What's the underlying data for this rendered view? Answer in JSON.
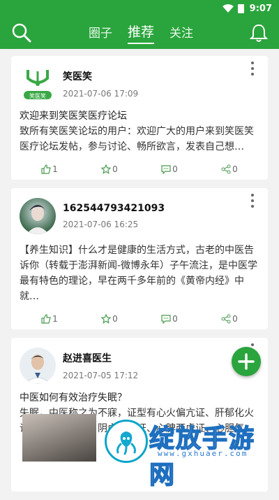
{
  "status_bar": {
    "time": "9:07"
  },
  "header": {
    "tabs": [
      {
        "label": "圈子"
      },
      {
        "label": "推荐",
        "active": true
      },
      {
        "label": "关注"
      }
    ]
  },
  "posts": [
    {
      "author": "笑医笑",
      "logo_text": "笑医笑",
      "date": "2021-07-06 17:09",
      "title": "欢迎来到笑医笑医疗论坛",
      "body": "致所有笑医笑论坛的用户：欢迎广大的用户来到笑医笑医疗论坛发帖，参与讨论、畅所欲言，发表自己想…",
      "likes": "1",
      "favorites": "0",
      "comments": "0",
      "shares": "0"
    },
    {
      "author": "162544793421093",
      "date": "2021-07-06 16:25",
      "title": "",
      "body": "【养生知识】什么才是健康的生活方式，古老的中医告诉你（转载于澎湃新闻-微博永年）子午流注，是中医学最有特色的理论，早在两千多年前的《黄帝内经》中就…",
      "likes": "1",
      "favorites": "0",
      "comments": "0",
      "shares": "0"
    },
    {
      "author": "赵进喜医生",
      "date": "2021-07-05 17:12",
      "title": "中医如何有效治疗失眠？",
      "body": "失眠，中医称之为不寐，证型有心火偏亢证、肝郁化火证、痰热内扰证、阴虚火旺证、心脾两虚证、心胆气…"
    }
  ],
  "watermark": {
    "text": "绽放手游网",
    "url": "www.gxhuaer.com"
  },
  "colors": {
    "primary": "#2aa43c"
  },
  "icons": [
    "search-icon",
    "bell-icon",
    "more-icon",
    "like-icon",
    "star-icon",
    "comment-icon",
    "share-icon",
    "plus-icon"
  ]
}
